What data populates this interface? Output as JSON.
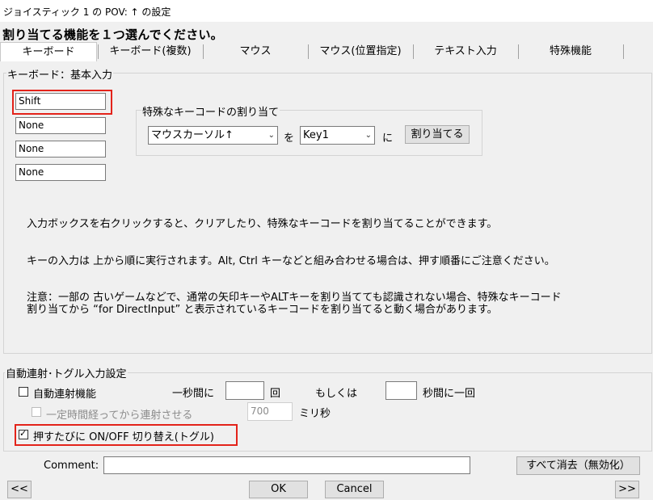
{
  "window": {
    "title": "ジョイスティック 1 の POV: ↑ の設定"
  },
  "heading": "割り当てる機能を１つ選んでください。",
  "tabs": [
    {
      "label": "キーボード"
    },
    {
      "label": "キーボード(複数)"
    },
    {
      "label": "マウス"
    },
    {
      "label": "マウス(位置指定)"
    },
    {
      "label": "テキスト入力"
    },
    {
      "label": "特殊機能"
    }
  ],
  "keyboard_group": {
    "label": "キーボード：基本入力",
    "inputs": [
      "Shift",
      "None",
      "None",
      "None"
    ]
  },
  "special_key": {
    "label": "特殊なキーコードの割り当て",
    "source_select": "マウスカーソル↑",
    "wo": "を",
    "target_select": "Key1",
    "ni": "に",
    "assign_button": "割り当てる"
  },
  "notes": [
    "入力ボックスを右クリックすると、クリアしたり、特殊なキーコードを割り当てることができます。",
    "キーの入力は 上から順に実行されます。Alt, Ctrl キーなどと組み合わせる場合は、押す順番にご注意ください。",
    "注意：一部の 古いゲームなどで、通常の矢印キーやALTキーを割り当てても認識されない場合、特殊なキーコード",
    "割り当てから “for DirectInput” と表示されているキーコードを割り当てると動く場合があります。"
  ],
  "autofire": {
    "label": "自動連射･トグル入力設定",
    "autofire_checkbox": "自動連射機能",
    "autofire_checked": false,
    "per_second_prefix": "一秒間に",
    "per_second_value": "",
    "per_second_suffix": "回",
    "or": "もしくは",
    "seconds_value": "",
    "seconds_suffix": "秒間に一回",
    "delay_checkbox": "一定時間経ってから連射させる",
    "delay_checked": false,
    "delay_value": "700",
    "delay_unit": "ミリ秒",
    "toggle_checkbox": "押すたびに ON/OFF 切り替え(トグル)",
    "toggle_checked": true
  },
  "bottom": {
    "comment_label": "Comment:",
    "comment_value": "",
    "clear_all_button": "すべて消去（無効化）",
    "prev_button": "<<",
    "ok_button": "OK",
    "cancel_button": "Cancel",
    "next_button": ">>"
  },
  "colors": {
    "highlight": "#e3231a",
    "window_bg": "#f0f0f0"
  }
}
